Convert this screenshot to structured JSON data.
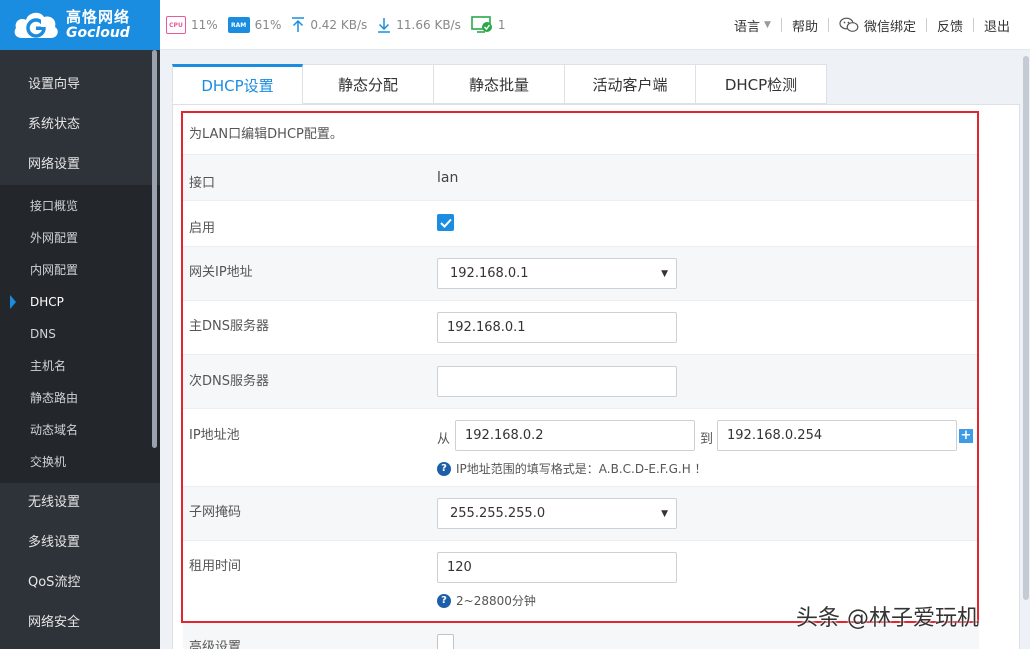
{
  "brand": {
    "name_cn": "高恪网络",
    "name_en": "Gocloud"
  },
  "status": {
    "cpu_icon": "CPU",
    "cpu": "11%",
    "ram_icon": "RAM",
    "ram": "61%",
    "upload": "0.42 KB/s",
    "download": "11.66 KB/s",
    "devices": "1"
  },
  "topnav": {
    "language": "语言",
    "help": "帮助",
    "wechat": "微信绑定",
    "feedback": "反馈",
    "logout": "退出"
  },
  "sidebar": {
    "main_top": [
      "设置向导",
      "系统状态",
      "网络设置"
    ],
    "sub": [
      "接口概览",
      "外网配置",
      "内网配置",
      "DHCP",
      "DNS",
      "主机名",
      "静态路由",
      "动态域名",
      "交换机"
    ],
    "active_sub": "DHCP",
    "main_bottom": [
      "无线设置",
      "多线设置",
      "QoS流控",
      "网络安全"
    ]
  },
  "tabs": [
    "DHCP设置",
    "静态分配",
    "静态批量",
    "活动客户端",
    "DHCP检测"
  ],
  "active_tab": "DHCP设置",
  "form": {
    "description": "为LAN口编辑DHCP配置。",
    "interface_label": "接口",
    "interface_value": "lan",
    "enable_label": "启用",
    "enabled": true,
    "gateway_label": "网关IP地址",
    "gateway_value": "192.168.0.1",
    "dns1_label": "主DNS服务器",
    "dns1_value": "192.168.0.1",
    "dns2_label": "次DNS服务器",
    "dns2_value": "",
    "pool_label": "IP地址池",
    "pool_from_label": "从",
    "pool_from": "192.168.0.2",
    "pool_to_label": "到",
    "pool_to": "192.168.0.254",
    "pool_hint": "IP地址范围的填写格式是：A.B.C.D-E.F.G.H ！",
    "mask_label": "子网掩码",
    "mask_value": "255.255.255.0",
    "lease_label": "租用时间",
    "lease_value": "120",
    "lease_hint": "2~28800分钟",
    "advanced_label": "高级设置",
    "advanced_enabled": false
  },
  "watermark": "头条 @林子爱玩机",
  "colors": {
    "brand": "#1a8de0",
    "sidebar": "#2e3339",
    "highlight_outline": "#e0262e"
  }
}
